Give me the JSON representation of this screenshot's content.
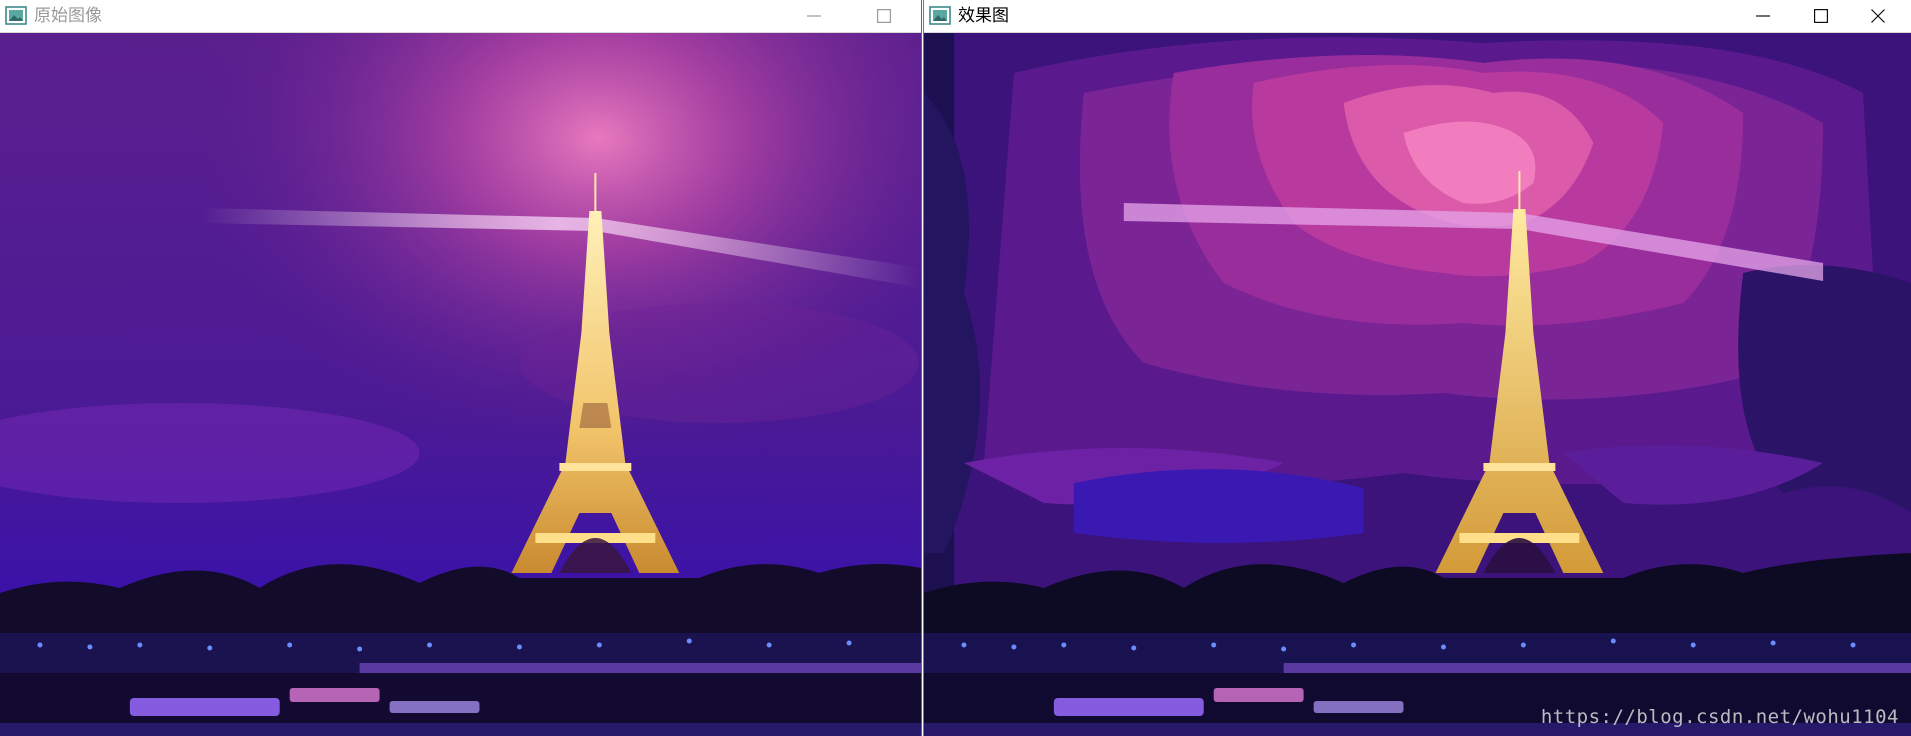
{
  "windows": {
    "left": {
      "title": "原始图像",
      "controls": [
        "minimize-icon",
        "maximize-icon"
      ],
      "image_description_icon": "image-window-icon"
    },
    "right": {
      "title": "效果图",
      "controls": [
        "minimize-icon",
        "maximize-icon",
        "close-icon"
      ],
      "image_description_icon": "image-window-icon"
    }
  },
  "watermark": "https://blog.csdn.net/wohu1104",
  "colors": {
    "sky_deep": "#2a0a5e",
    "sky_mid": "#6a1e9e",
    "glow_pink": "#e96fb8",
    "tower_gold": "#f2c46a",
    "city_dark": "#0a0a1e",
    "city_lights": "#4f6bff",
    "window_accent": "#2b73c4"
  }
}
